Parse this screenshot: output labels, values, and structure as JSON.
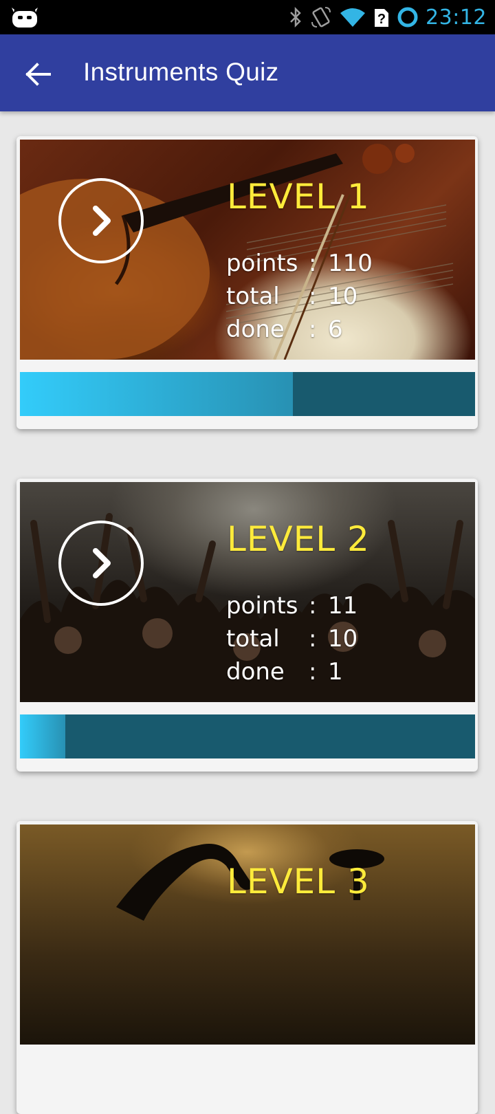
{
  "status_bar": {
    "time": "23:12",
    "icons": [
      "android-icon",
      "bluetooth-icon",
      "rotation-icon",
      "wifi-icon",
      "sim-question-icon",
      "ring-icon"
    ]
  },
  "app_bar": {
    "title": "Instruments Quiz",
    "back_icon": "arrow-back-icon",
    "color": "#303f9f"
  },
  "levels": [
    {
      "title": "LEVEL 1",
      "points_label": "points",
      "points": "110",
      "total_label": "total",
      "total": "10",
      "done_label": "done",
      "done": "6",
      "separator": ":",
      "progress": 0.6,
      "image": "violin"
    },
    {
      "title": "LEVEL 2",
      "points_label": "points",
      "points": "11",
      "total_label": "total",
      "total": "10",
      "done_label": "done",
      "done": "1",
      "separator": ":",
      "progress": 0.1,
      "image": "concert-crowd"
    },
    {
      "title": "LEVEL 3",
      "image": "saxophone"
    }
  ],
  "colors": {
    "title_yellow": "#ffeb3b",
    "progress_track": "#185a6e",
    "progress_fill": "#33ccfa"
  }
}
